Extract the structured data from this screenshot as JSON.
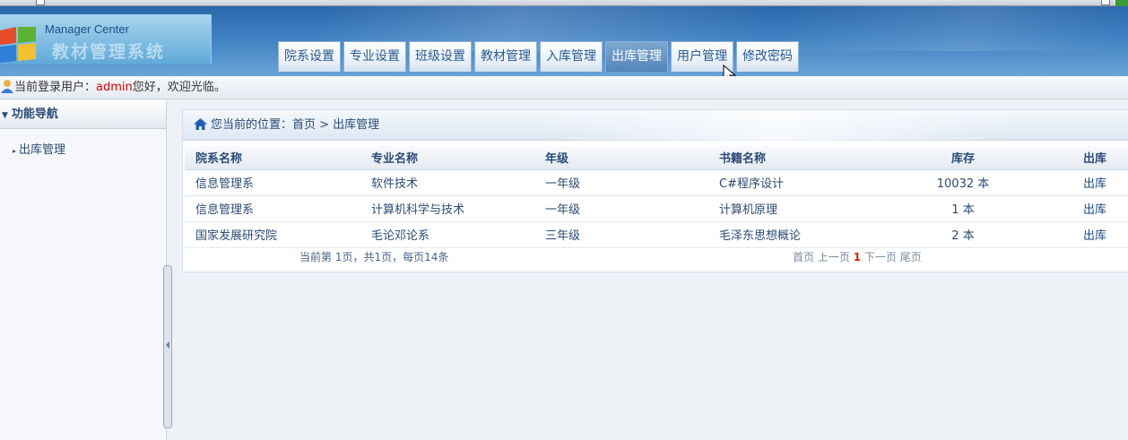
{
  "app": {
    "logo_subtitle": "Manager Center",
    "logo_title": "教材管理系统"
  },
  "nav": {
    "tabs": [
      {
        "label": "院系设置"
      },
      {
        "label": "专业设置"
      },
      {
        "label": "班级设置"
      },
      {
        "label": "教材管理"
      },
      {
        "label": "入库管理"
      },
      {
        "label": "出库管理",
        "active": true
      },
      {
        "label": "用户管理"
      },
      {
        "label": "修改密码"
      }
    ]
  },
  "userbar": {
    "prefix": "当前登录用户：",
    "username": "admin",
    "suffix": "您好，欢迎光临。"
  },
  "sidebar": {
    "title": "功能导航",
    "items": [
      {
        "label": "出库管理"
      }
    ]
  },
  "breadcrumb": {
    "text": "您当前的位置：首页 > 出库管理"
  },
  "table": {
    "headers": [
      "院系名称",
      "专业名称",
      "年级",
      "书籍名称",
      "库存",
      "出库"
    ],
    "rows": [
      {
        "dept": "信息管理系",
        "major": "软件技术",
        "grade": "一年级",
        "book": "C#程序设计",
        "stock": "10032 本",
        "action": "出库"
      },
      {
        "dept": "信息管理系",
        "major": "计算机科学与技术",
        "grade": "一年级",
        "book": "计算机原理",
        "stock": "1 本",
        "action": "出库"
      },
      {
        "dept": "国家发展研究院",
        "major": "毛论邓论系",
        "grade": "三年级",
        "book": "毛泽东思想概论",
        "stock": "2 本",
        "action": "出库"
      }
    ]
  },
  "pager": {
    "summary": "当前第  1页，共1页，每页14条",
    "first": "首页",
    "prev": "上一页",
    "current": "1",
    "next": "下一页",
    "last": "尾页"
  },
  "colors": {
    "header_blue": "#3f80c2",
    "active_tab": "#5584b9",
    "username_red": "#e00000",
    "current_page_red": "#d12a00"
  },
  "icons": [
    "home-icon",
    "user-icon",
    "logo-icon",
    "mouse-cursor-icon",
    "collapse-arrow-icon"
  ]
}
